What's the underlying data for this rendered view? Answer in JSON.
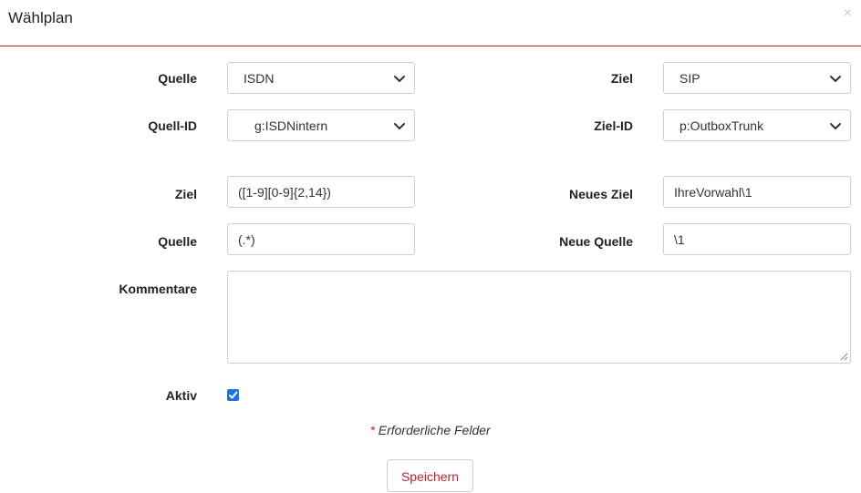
{
  "dialog": {
    "title": "Wählplan",
    "close_glyph": "×"
  },
  "form": {
    "quelle": {
      "label": "Quelle",
      "value": "ISDN"
    },
    "ziel": {
      "label": "Ziel",
      "value": "SIP"
    },
    "quell_id": {
      "label": "Quell-ID",
      "value": "g:ISDNintern"
    },
    "ziel_id": {
      "label": "Ziel-ID",
      "value": "p:OutboxTrunk"
    },
    "ziel_pattern": {
      "label": "Ziel",
      "value": "([1-9][0-9]{2,14})"
    },
    "neues_ziel": {
      "label": "Neues Ziel",
      "value": "IhreVorwahl\\1"
    },
    "quelle_pattern": {
      "label": "Quelle",
      "value": "(.*)"
    },
    "neue_quelle": {
      "label": "Neue Quelle",
      "value": "\\1"
    },
    "kommentare": {
      "label": "Kommentare",
      "value": ""
    },
    "aktiv": {
      "label": "Aktiv",
      "checked": true
    }
  },
  "footer": {
    "required_star": "*",
    "required_text": "Erforderliche Felder",
    "save_label": "Speichern"
  },
  "colors": {
    "accent": "#b7262f",
    "checkbox": "#1a73e8",
    "required_star": "#c62828"
  },
  "icons": {
    "select_arrow": "chevron-down-icon",
    "close": "close-icon",
    "checkmark": "check-icon"
  }
}
